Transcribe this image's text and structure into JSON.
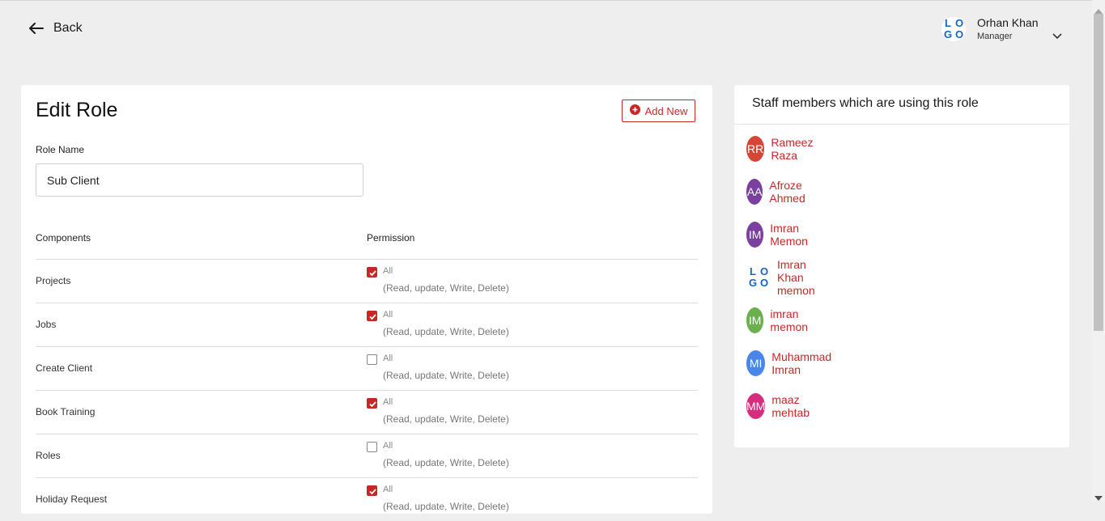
{
  "header": {
    "back_label": "Back",
    "logo_text": [
      "L",
      "O",
      "G",
      "O"
    ],
    "user_name": "Orhan Khan",
    "user_role": "Manager"
  },
  "edit_role": {
    "title": "Edit Role",
    "add_new_label": "Add New",
    "role_name_label": "Role Name",
    "role_name_value": "Sub Client",
    "col_components": "Components",
    "col_permission": "Permission",
    "rows": [
      {
        "component": "Projects",
        "checked": true,
        "all": "All",
        "desc": "(Read, update, Write, Delete)"
      },
      {
        "component": "Jobs",
        "checked": true,
        "all": "All",
        "desc": "(Read, update, Write, Delete)"
      },
      {
        "component": "Create Client",
        "checked": false,
        "all": "All",
        "desc": "(Read, update, Write, Delete)"
      },
      {
        "component": "Book Training",
        "checked": true,
        "all": "All",
        "desc": "(Read, update, Write, Delete)"
      },
      {
        "component": "Roles",
        "checked": false,
        "all": "All",
        "desc": "(Read, update, Write, Delete)"
      },
      {
        "component": "Holiday Request",
        "checked": true,
        "all": "All",
        "desc": "(Read, update, Write, Delete)"
      }
    ]
  },
  "staff_panel": {
    "title": "Staff members which are using this role",
    "members": [
      {
        "initials": "RR",
        "name": "Rameez Raza",
        "color": "#d64535"
      },
      {
        "initials": "AA",
        "name": "Afroze Ahmed",
        "color": "#7b3fa0"
      },
      {
        "initials": "IM",
        "name": "Imran Memon",
        "color": "#7b3fa0"
      },
      {
        "initials": "",
        "name": "Imran Khan memon",
        "color": "#ffffff",
        "avatar": "logo"
      },
      {
        "initials": "IM",
        "name": "imran memon",
        "color": "#6ab04c"
      },
      {
        "initials": "MI",
        "name": "Muhammad Imran",
        "color": "#4a86e8"
      },
      {
        "initials": "MM",
        "name": "maaz mehtab",
        "color": "#d62d7e"
      }
    ]
  },
  "colors": {
    "accent": "#c62828",
    "background": "#eeeeee",
    "logo_blue": "#1565c0"
  }
}
